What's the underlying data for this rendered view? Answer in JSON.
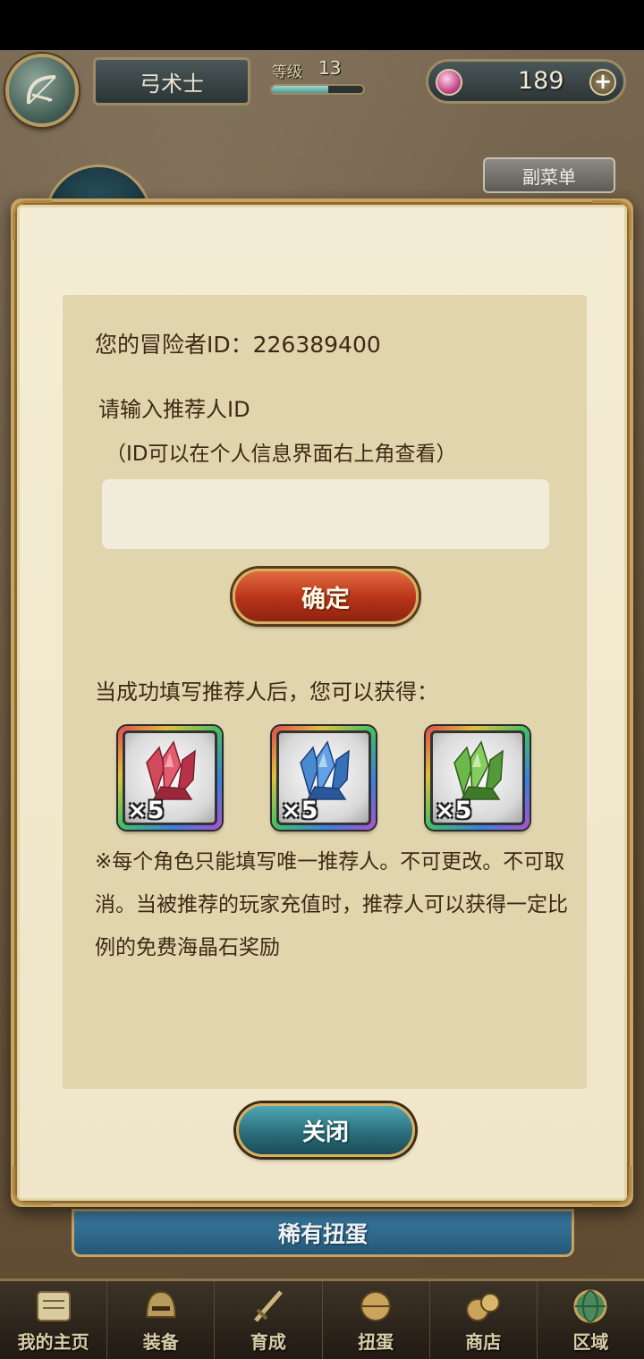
{
  "hud": {
    "class_name": "弓术士",
    "level_label": "等级",
    "level_value": "13",
    "level_progress": 0.62,
    "gem_count": "189",
    "add_symbol": "+"
  },
  "sub_menu_label": "副菜单",
  "modal": {
    "adventurer_id_line": "您的冒险者ID：226389400",
    "referrer_prompt": "请输入推荐人ID",
    "referrer_hint": "（ID可以在个人信息界面右上角查看）",
    "referrer_input_value": "",
    "confirm_label": "确定",
    "reward_heading": "当成功填写推荐人后，您可以获得：",
    "rewards": [
      {
        "icon": "red-crystal-icon",
        "count": "×5",
        "color": "#c83a4a"
      },
      {
        "icon": "blue-crystal-icon",
        "count": "×5",
        "color": "#3f86c4"
      },
      {
        "icon": "green-crystal-icon",
        "count": "×5",
        "color": "#5faa3a"
      }
    ],
    "notice": "※每个角色只能填写唯一推荐人。不可更改。不可取消。当被推荐的玩家充值时，推荐人可以获得一定比例的免费海晶石奖励",
    "close_label": "关闭"
  },
  "gacha_banner_label": "稀有扭蛋",
  "bottom_nav": [
    {
      "label": "我的主页",
      "icon": "scroll-icon"
    },
    {
      "label": "装备",
      "icon": "helmet-icon"
    },
    {
      "label": "育成",
      "icon": "sword-icon"
    },
    {
      "label": "扭蛋",
      "icon": "gacha-capsule-icon"
    },
    {
      "label": "商店",
      "icon": "gold-coins-icon"
    },
    {
      "label": "区域",
      "icon": "globe-icon"
    }
  ]
}
